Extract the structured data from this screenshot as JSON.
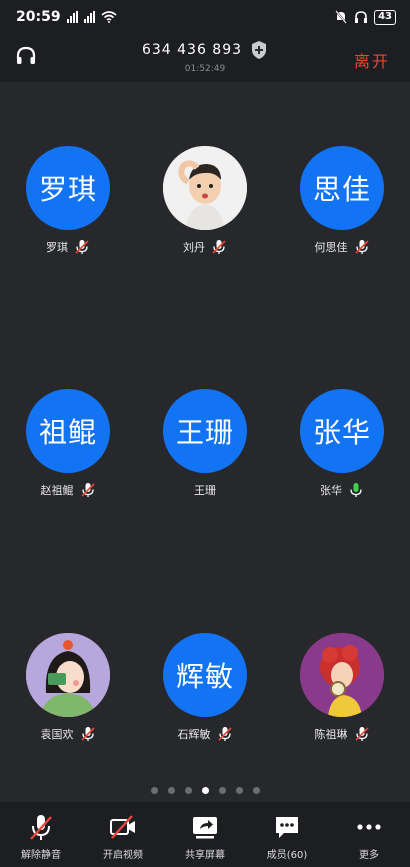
{
  "status_bar": {
    "time": "20:59",
    "battery": "43"
  },
  "header": {
    "meeting_id": "634 436 893",
    "timer": "01:52:49",
    "leave_label": "离开"
  },
  "participants": [
    {
      "name": "罗琪",
      "avatar_text": "罗琪",
      "avatar_type": "text",
      "mic": "muted"
    },
    {
      "name": "刘丹",
      "avatar_text": "",
      "avatar_type": "photo-boy",
      "mic": "muted"
    },
    {
      "name": "何思佳",
      "avatar_text": "思佳",
      "avatar_type": "text",
      "mic": "muted"
    },
    {
      "name": "赵祖鲲",
      "avatar_text": "祖鲲",
      "avatar_type": "text",
      "mic": "muted"
    },
    {
      "name": "王珊",
      "avatar_text": "王珊",
      "avatar_type": "text",
      "mic": "none"
    },
    {
      "name": "张华",
      "avatar_text": "张华",
      "avatar_type": "text",
      "mic": "active"
    },
    {
      "name": "袁国欢",
      "avatar_text": "",
      "avatar_type": "photo-girl",
      "mic": "muted"
    },
    {
      "name": "石辉敏",
      "avatar_text": "辉敏",
      "avatar_type": "text",
      "mic": "muted"
    },
    {
      "name": "陈祖琳",
      "avatar_text": "",
      "avatar_type": "photo-woman",
      "mic": "muted"
    }
  ],
  "pagination": {
    "total": 7,
    "active_index": 3
  },
  "toolbar": {
    "unmute_label": "解除静音",
    "video_label": "开启视频",
    "share_label": "共享屏幕",
    "members_label": "成员(60)",
    "more_label": "更多"
  },
  "colors": {
    "accent": "#1373f5",
    "leave": "#e8463b",
    "muted_mic": "#e8463b",
    "active_mic": "#3fd14a",
    "background": "#26282c",
    "bar": "#1d1e21"
  }
}
